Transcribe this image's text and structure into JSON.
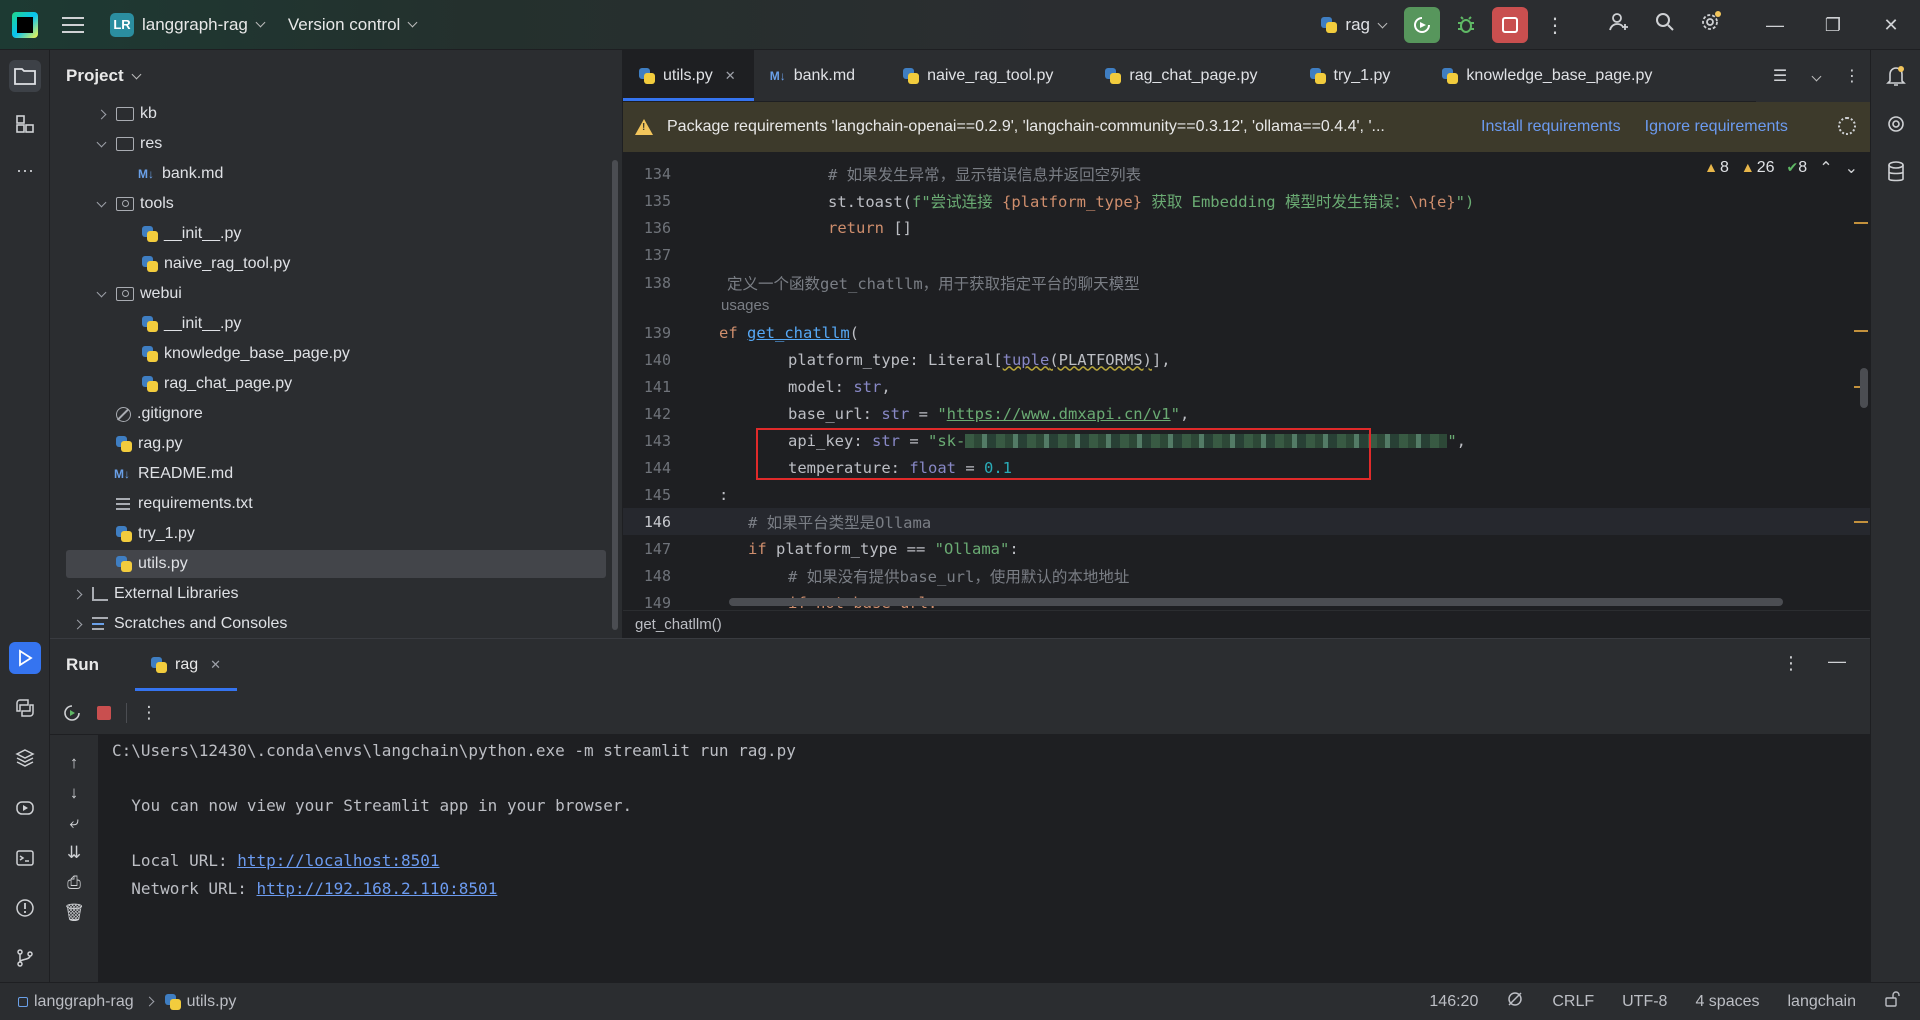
{
  "titlebar": {
    "project_badge": "LR",
    "project_name": "langgraph-rag",
    "vcs_label": "Version control",
    "run_config": "rag"
  },
  "project_panel": {
    "title": "Project",
    "items": [
      {
        "label": "kb",
        "type": "folder",
        "indent": 1,
        "state": "collapsed"
      },
      {
        "label": "res",
        "type": "folder",
        "indent": 1,
        "state": "expanded"
      },
      {
        "label": "bank.md",
        "type": "md",
        "indent": 3
      },
      {
        "label": "tools",
        "type": "package",
        "indent": 1,
        "state": "expanded"
      },
      {
        "label": "__init__.py",
        "type": "py",
        "indent": 3
      },
      {
        "label": "naive_rag_tool.py",
        "type": "py",
        "indent": 3
      },
      {
        "label": "webui",
        "type": "package",
        "indent": 1,
        "state": "expanded"
      },
      {
        "label": "__init__.py",
        "type": "py",
        "indent": 3
      },
      {
        "label": "knowledge_base_page.py",
        "type": "py",
        "indent": 3
      },
      {
        "label": "rag_chat_page.py",
        "type": "py",
        "indent": 3
      },
      {
        "label": ".gitignore",
        "type": "gitignore",
        "indent": 2
      },
      {
        "label": "rag.py",
        "type": "py",
        "indent": 2
      },
      {
        "label": "README.md",
        "type": "md",
        "indent": 2
      },
      {
        "label": "requirements.txt",
        "type": "txt",
        "indent": 2
      },
      {
        "label": "try_1.py",
        "type": "py",
        "indent": 2
      },
      {
        "label": "utils.py",
        "type": "py",
        "indent": 2,
        "selected": true
      },
      {
        "label": "External Libraries",
        "type": "lib",
        "indent": 0,
        "state": "collapsed"
      },
      {
        "label": "Scratches and Consoles",
        "type": "scratch",
        "indent": 0,
        "state": "collapsed"
      }
    ]
  },
  "editor": {
    "tabs": [
      {
        "label": "utils.py",
        "type": "py",
        "active": true
      },
      {
        "label": "bank.md",
        "type": "md"
      },
      {
        "label": "naive_rag_tool.py",
        "type": "py"
      },
      {
        "label": "rag_chat_page.py",
        "type": "py"
      },
      {
        "label": "try_1.py",
        "type": "py"
      },
      {
        "label": "knowledge_base_page.py",
        "type": "py"
      }
    ],
    "banner": {
      "text": "Package requirements 'langchain-openai==0.2.9', 'langchain-community==0.3.12', 'ollama==0.4.4', '...",
      "install_link": "Install requirements",
      "ignore_link": "Ignore requirements"
    },
    "inspections": {
      "warnings_a": "8",
      "warnings_b": "26",
      "ok": "8"
    },
    "line_numbers": [
      "134",
      "135",
      "136",
      "137",
      "138",
      "139",
      "140",
      "141",
      "142",
      "143",
      "144",
      "145",
      "146",
      "147",
      "148",
      "149"
    ],
    "current_line": "146",
    "code": {
      "l134": "# 如果发生异常，显示错误信息并返回空列表",
      "l135_a": "st.toast(",
      "l135_b": "f\"尝试连接 ",
      "l135_c": "{platform_type}",
      "l135_d": " 获取 Embedding 模型时发生错误：",
      "l135_e": "\\n",
      "l135_f": "{e}",
      "l135_g": "\")",
      "l136_kw": "return",
      "l136_rest": " []",
      "l138": "定义一个函数get_chatllm，用于获取指定平台的聊天模型",
      "usages": "usages",
      "l139_kw": "ef",
      "l139_fn": "get_chatllm",
      "l139_rest": "(",
      "l140_a": "platform_type: Literal[",
      "l140_b": "tuple",
      "l140_c": "(PLATFORMS)",
      "l140_d": "],",
      "l141_a": "model: ",
      "l141_b": "str",
      "l141_c": ",",
      "l142_a": "base_url: ",
      "l142_b": "str",
      "l142_c": " = ",
      "l142_d": "\"",
      "l142_url": "https://www.dmxapi.cn/v1",
      "l142_e": "\"",
      "l142_f": ",",
      "l143_a": "api_key: ",
      "l143_b": "str",
      "l143_c": " = ",
      "l143_d": "\"sk-",
      "l143_e": "\"",
      "l143_f": ",",
      "l144_a": "temperature: ",
      "l144_b": "float",
      "l144_c": " = ",
      "l144_d": "0.1",
      "l145": ":",
      "l146": "# 如果平台类型是Ollama",
      "l147_kw": "if",
      "l147_a": " platform_type == ",
      "l147_str": "\"Ollama\"",
      "l147_b": ":",
      "l148": "# 如果没有提供base_url，使用默认的本地地址",
      "l149": "if not base_url:"
    },
    "breadcrumb": "get_chatllm()"
  },
  "run_panel": {
    "title": "Run",
    "tab_label": "rag",
    "console": {
      "cmd": "C:\\Users\\12430\\.conda\\envs\\langchain\\python.exe -m streamlit run rag.py",
      "msg": "  You can now view your Streamlit app in your browser.",
      "local_label": "  Local URL: ",
      "local_url": "http://localhost:8501",
      "network_label": "  Network URL: ",
      "network_url": "http://192.168.2.110:8501"
    }
  },
  "statusbar": {
    "project": "langgraph-rag",
    "file": "utils.py",
    "position": "146:20",
    "line_sep": "CRLF",
    "encoding": "UTF-8",
    "indent": "4 spaces",
    "interpreter": "langchain"
  }
}
